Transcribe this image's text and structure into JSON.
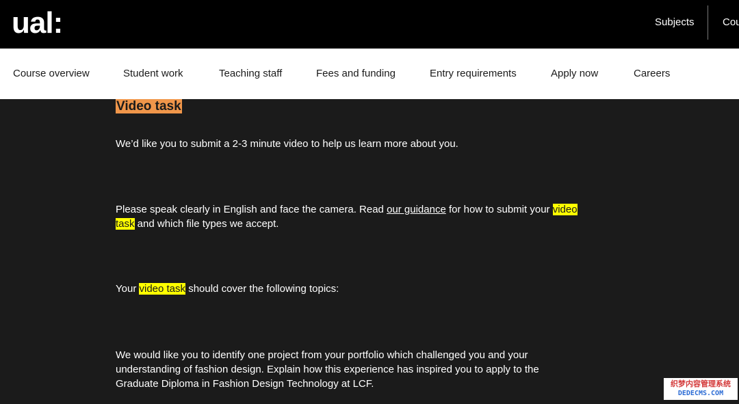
{
  "header": {
    "logo": "ual:",
    "links": [
      {
        "label": "Subjects"
      },
      {
        "label": "Cou"
      }
    ]
  },
  "subnav": {
    "items": [
      {
        "label": "Course overview"
      },
      {
        "label": "Student work"
      },
      {
        "label": "Teaching staff"
      },
      {
        "label": "Fees and funding"
      },
      {
        "label": "Entry requirements"
      },
      {
        "label": "Apply now"
      },
      {
        "label": "Careers"
      }
    ]
  },
  "content": {
    "heading": "Video task",
    "p1": "We’d like you to submit a 2-3 minute video to help us learn more about you.",
    "p2": {
      "before_link": "Please speak clearly in English and face the camera. Read ",
      "link": "our guidance",
      "after_link": " for how to submit your ",
      "highlight_a": "video",
      "highlight_b": "task",
      "end": " and which file types we accept."
    },
    "p3": {
      "before": "Your ",
      "highlight": "video task",
      "after": " should cover the following topics:"
    },
    "p4": "We would like you to identify one project from your portfolio which challenged you and your understanding of fashion design. Explain how this experience has inspired you to apply to the Graduate Diploma in Fashion Design Technology at LCF."
  },
  "watermark": {
    "line1": "织梦内容管理系统",
    "line2": "DEDECMS.COM"
  },
  "colors": {
    "topbar": "#000000",
    "subnav": "#ffffff",
    "content_bg": "#1b1b1b",
    "heading_bg": "#f0964a",
    "highlight": "#ffff00"
  }
}
